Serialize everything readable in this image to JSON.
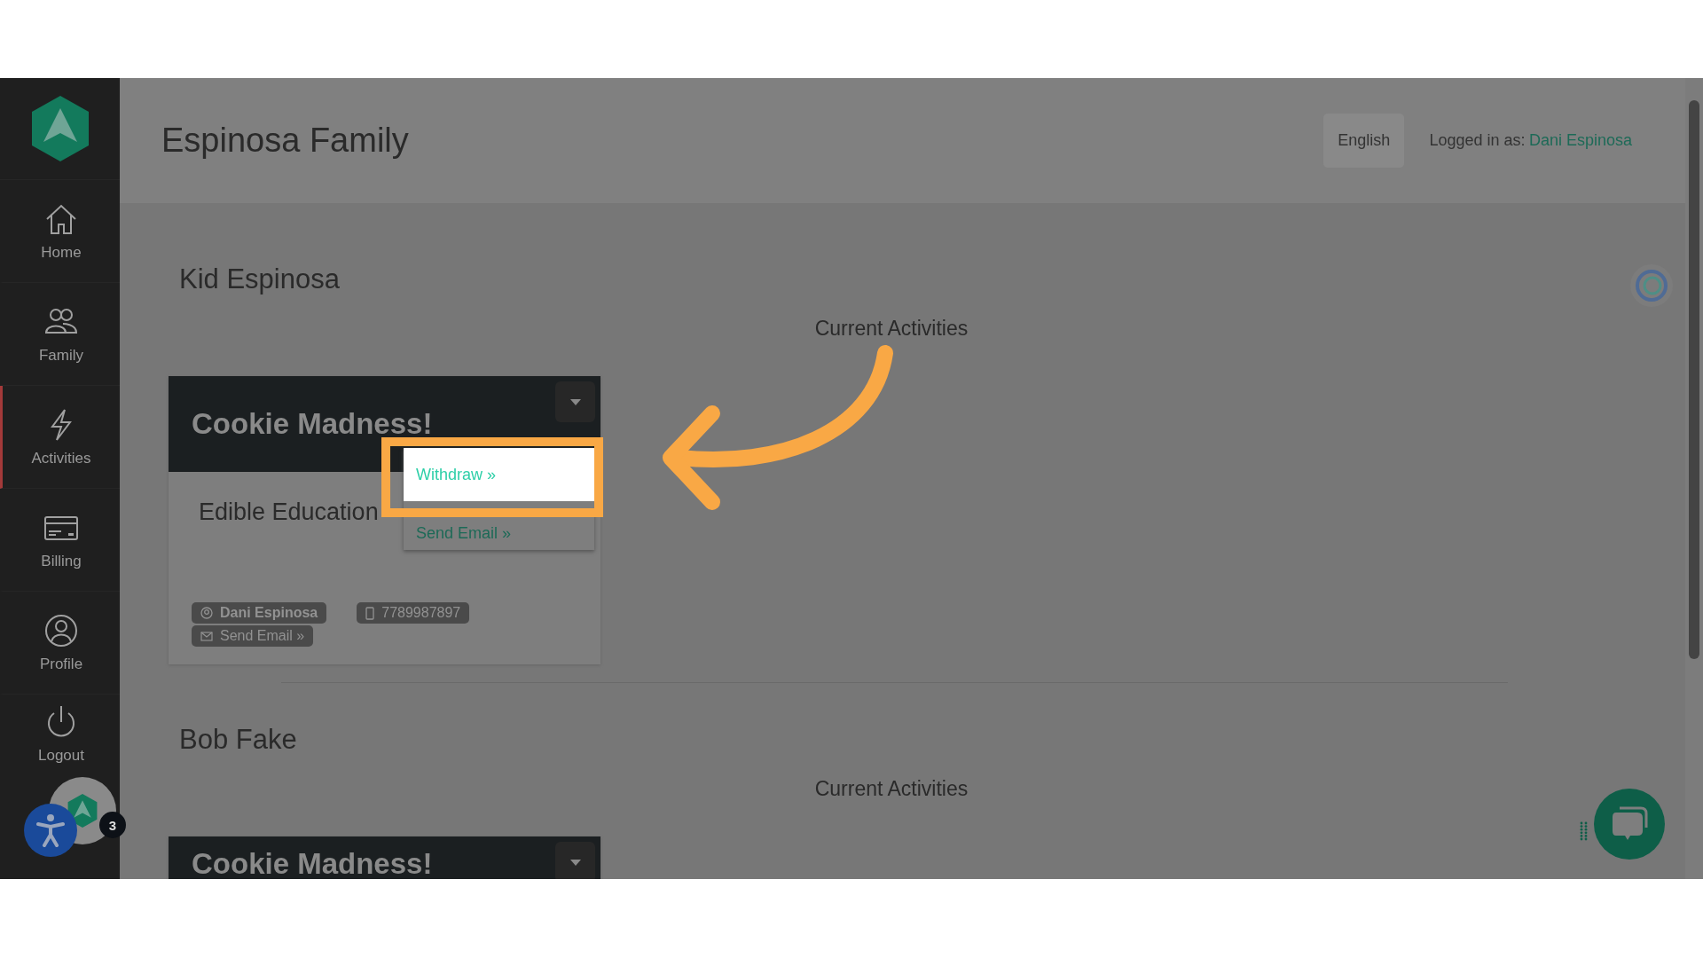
{
  "sidebar": {
    "items": [
      {
        "label": "Home",
        "kind": "home",
        "selected": false
      },
      {
        "label": "Family",
        "kind": "family",
        "selected": false
      },
      {
        "label": "Activities",
        "kind": "activities",
        "selected": true
      },
      {
        "label": "Billing",
        "kind": "billing",
        "selected": false
      },
      {
        "label": "Profile",
        "kind": "profile",
        "selected": false
      },
      {
        "label": "Logout",
        "kind": "logout",
        "selected": false
      }
    ]
  },
  "header": {
    "title": "Espinosa Family",
    "language_button": "English",
    "logged_in_label": "Logged in as:",
    "logged_in_user": "Dani Espinosa"
  },
  "kids": [
    {
      "name": "Kid Espinosa",
      "section_title": "Current Activities",
      "activities": [
        {
          "title": "Cookie Madness!",
          "provider": "Edible Education",
          "contact_name": "Dani Espinosa",
          "phone": "7789987897",
          "email_link": "Send Email »",
          "menu_open": true,
          "menu": [
            {
              "label": "Withdraw »",
              "highlighted": true
            },
            {
              "label": "Send Email »",
              "highlighted": false
            }
          ]
        }
      ]
    },
    {
      "name": "Bob Fake",
      "section_title": "Current Activities",
      "activities": [
        {
          "title": "Cookie Madness!"
        }
      ]
    }
  ],
  "notification_badge": "3"
}
